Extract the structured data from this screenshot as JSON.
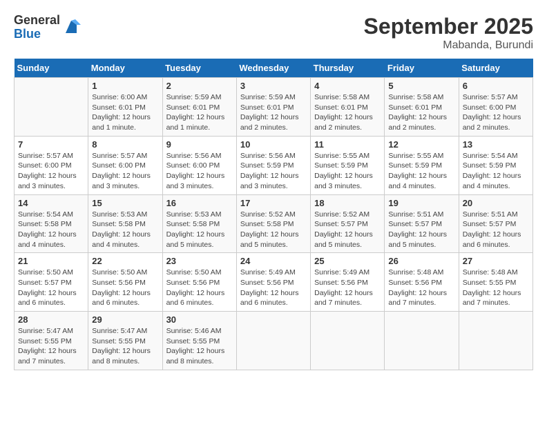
{
  "logo": {
    "general": "General",
    "blue": "Blue"
  },
  "title": "September 2025",
  "location": "Mabanda, Burundi",
  "days_header": [
    "Sunday",
    "Monday",
    "Tuesday",
    "Wednesday",
    "Thursday",
    "Friday",
    "Saturday"
  ],
  "weeks": [
    [
      {
        "day": "",
        "info": ""
      },
      {
        "day": "1",
        "info": "Sunrise: 6:00 AM\nSunset: 6:01 PM\nDaylight: 12 hours\nand 1 minute."
      },
      {
        "day": "2",
        "info": "Sunrise: 5:59 AM\nSunset: 6:01 PM\nDaylight: 12 hours\nand 1 minute."
      },
      {
        "day": "3",
        "info": "Sunrise: 5:59 AM\nSunset: 6:01 PM\nDaylight: 12 hours\nand 2 minutes."
      },
      {
        "day": "4",
        "info": "Sunrise: 5:58 AM\nSunset: 6:01 PM\nDaylight: 12 hours\nand 2 minutes."
      },
      {
        "day": "5",
        "info": "Sunrise: 5:58 AM\nSunset: 6:01 PM\nDaylight: 12 hours\nand 2 minutes."
      },
      {
        "day": "6",
        "info": "Sunrise: 5:57 AM\nSunset: 6:00 PM\nDaylight: 12 hours\nand 2 minutes."
      }
    ],
    [
      {
        "day": "7",
        "info": "Sunrise: 5:57 AM\nSunset: 6:00 PM\nDaylight: 12 hours\nand 3 minutes."
      },
      {
        "day": "8",
        "info": "Sunrise: 5:57 AM\nSunset: 6:00 PM\nDaylight: 12 hours\nand 3 minutes."
      },
      {
        "day": "9",
        "info": "Sunrise: 5:56 AM\nSunset: 6:00 PM\nDaylight: 12 hours\nand 3 minutes."
      },
      {
        "day": "10",
        "info": "Sunrise: 5:56 AM\nSunset: 5:59 PM\nDaylight: 12 hours\nand 3 minutes."
      },
      {
        "day": "11",
        "info": "Sunrise: 5:55 AM\nSunset: 5:59 PM\nDaylight: 12 hours\nand 3 minutes."
      },
      {
        "day": "12",
        "info": "Sunrise: 5:55 AM\nSunset: 5:59 PM\nDaylight: 12 hours\nand 4 minutes."
      },
      {
        "day": "13",
        "info": "Sunrise: 5:54 AM\nSunset: 5:59 PM\nDaylight: 12 hours\nand 4 minutes."
      }
    ],
    [
      {
        "day": "14",
        "info": "Sunrise: 5:54 AM\nSunset: 5:58 PM\nDaylight: 12 hours\nand 4 minutes."
      },
      {
        "day": "15",
        "info": "Sunrise: 5:53 AM\nSunset: 5:58 PM\nDaylight: 12 hours\nand 4 minutes."
      },
      {
        "day": "16",
        "info": "Sunrise: 5:53 AM\nSunset: 5:58 PM\nDaylight: 12 hours\nand 5 minutes."
      },
      {
        "day": "17",
        "info": "Sunrise: 5:52 AM\nSunset: 5:58 PM\nDaylight: 12 hours\nand 5 minutes."
      },
      {
        "day": "18",
        "info": "Sunrise: 5:52 AM\nSunset: 5:57 PM\nDaylight: 12 hours\nand 5 minutes."
      },
      {
        "day": "19",
        "info": "Sunrise: 5:51 AM\nSunset: 5:57 PM\nDaylight: 12 hours\nand 5 minutes."
      },
      {
        "day": "20",
        "info": "Sunrise: 5:51 AM\nSunset: 5:57 PM\nDaylight: 12 hours\nand 6 minutes."
      }
    ],
    [
      {
        "day": "21",
        "info": "Sunrise: 5:50 AM\nSunset: 5:57 PM\nDaylight: 12 hours\nand 6 minutes."
      },
      {
        "day": "22",
        "info": "Sunrise: 5:50 AM\nSunset: 5:56 PM\nDaylight: 12 hours\nand 6 minutes."
      },
      {
        "day": "23",
        "info": "Sunrise: 5:50 AM\nSunset: 5:56 PM\nDaylight: 12 hours\nand 6 minutes."
      },
      {
        "day": "24",
        "info": "Sunrise: 5:49 AM\nSunset: 5:56 PM\nDaylight: 12 hours\nand 6 minutes."
      },
      {
        "day": "25",
        "info": "Sunrise: 5:49 AM\nSunset: 5:56 PM\nDaylight: 12 hours\nand 7 minutes."
      },
      {
        "day": "26",
        "info": "Sunrise: 5:48 AM\nSunset: 5:56 PM\nDaylight: 12 hours\nand 7 minutes."
      },
      {
        "day": "27",
        "info": "Sunrise: 5:48 AM\nSunset: 5:55 PM\nDaylight: 12 hours\nand 7 minutes."
      }
    ],
    [
      {
        "day": "28",
        "info": "Sunrise: 5:47 AM\nSunset: 5:55 PM\nDaylight: 12 hours\nand 7 minutes."
      },
      {
        "day": "29",
        "info": "Sunrise: 5:47 AM\nSunset: 5:55 PM\nDaylight: 12 hours\nand 8 minutes."
      },
      {
        "day": "30",
        "info": "Sunrise: 5:46 AM\nSunset: 5:55 PM\nDaylight: 12 hours\nand 8 minutes."
      },
      {
        "day": "",
        "info": ""
      },
      {
        "day": "",
        "info": ""
      },
      {
        "day": "",
        "info": ""
      },
      {
        "day": "",
        "info": ""
      }
    ]
  ]
}
